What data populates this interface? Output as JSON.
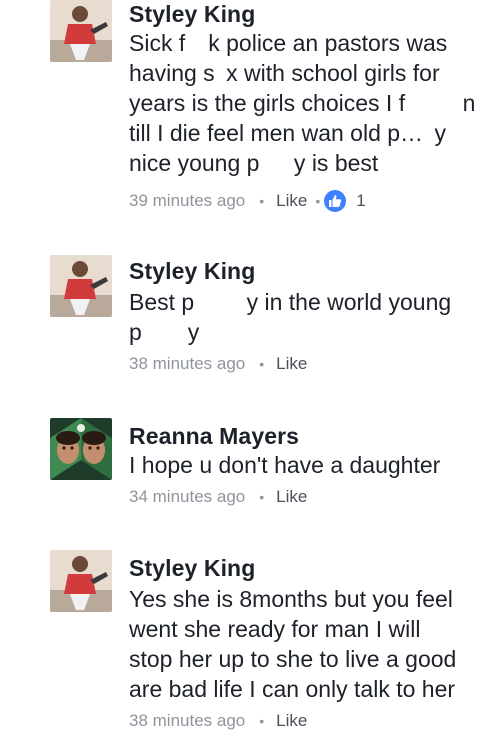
{
  "comments": [
    {
      "author": "Styley King",
      "lines": [
        "Sick f k police an pastors was",
        "having s x with school girls for",
        "years is the girls choices I f   n",
        "till I die feel men wan old p… y",
        "nice young p   y is best"
      ],
      "time": "39 minutes ago",
      "like_label": "Like",
      "reaction_count": "1",
      "avatar_icon": "profile-photo"
    },
    {
      "author": "Styley King",
      "lines": [
        "Best p   y in the world young",
        "p  y"
      ],
      "time": "38 minutes ago",
      "like_label": "Like",
      "avatar_icon": "profile-photo"
    },
    {
      "author": "Reanna Mayers",
      "lines": [
        "I hope u don't have a daughter"
      ],
      "time": "34 minutes ago",
      "like_label": "Like",
      "avatar_icon": "profile-photo"
    },
    {
      "author": "Styley King",
      "lines": [
        "Yes she is 8months but you feel",
        "went she ready for man I will",
        "stop her up to she to live a good",
        "are bad life I can only talk to her"
      ],
      "time": "38 minutes ago",
      "like_label": "Like",
      "avatar_icon": "profile-photo"
    }
  ],
  "colors": {
    "text": "#1d2129",
    "meta": "#90949c",
    "like_blue": "#4080ff"
  }
}
